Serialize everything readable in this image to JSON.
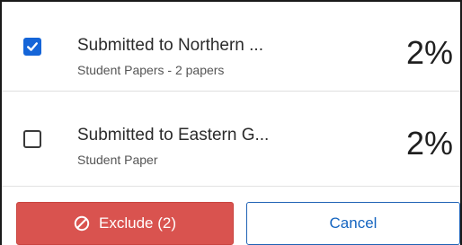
{
  "sources": [
    {
      "title": "Submitted to Northern ...",
      "subtitle": "Student Papers - 2 papers",
      "percent": "2%",
      "checked": true
    },
    {
      "title": "Submitted to Eastern G...",
      "subtitle": "Student Paper",
      "percent": "2%",
      "checked": false
    }
  ],
  "footer": {
    "exclude_label": "Exclude (2)",
    "exclude_icon": "block-icon",
    "cancel_label": "Cancel"
  },
  "colors": {
    "exclude_bg": "#d9534f",
    "checkbox_checked": "#1565d8",
    "cancel_text": "#1565c0"
  }
}
